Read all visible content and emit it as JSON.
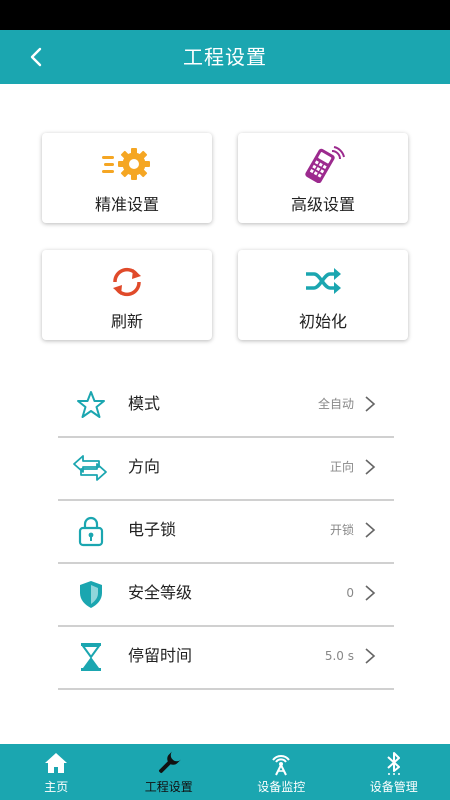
{
  "header": {
    "title": "工程设置"
  },
  "quick_actions": [
    {
      "label": "精准设置",
      "icon": "gear-motion-icon",
      "color": "#f5a623"
    },
    {
      "label": "高级设置",
      "icon": "remote-control-icon",
      "color": "#9c2a8e"
    },
    {
      "label": "刷新",
      "icon": "refresh-icon",
      "color": "#e04a2a"
    },
    {
      "label": "初始化",
      "icon": "shuffle-icon",
      "color": "#1ba6b0"
    }
  ],
  "settings": [
    {
      "label": "模式",
      "value": "全自动",
      "icon": "star-icon"
    },
    {
      "label": "方向",
      "value": "正向",
      "icon": "direction-arrows-icon"
    },
    {
      "label": "电子锁",
      "value": "开锁",
      "icon": "lock-icon"
    },
    {
      "label": "安全等级",
      "value": "0",
      "icon": "shield-icon"
    },
    {
      "label": "停留时间",
      "value": "5.0 s",
      "icon": "hourglass-icon"
    }
  ],
  "tabbar": {
    "active": 1,
    "tabs": [
      {
        "label": "主页",
        "icon": "home-icon"
      },
      {
        "label": "工程设置",
        "icon": "wrench-icon"
      },
      {
        "label": "设备监控",
        "icon": "signal-tower-icon"
      },
      {
        "label": "设备管理",
        "icon": "bluetooth-icon"
      }
    ]
  },
  "colors": {
    "accent": "#1ba6b0",
    "divider": "#d0d0d0",
    "value_text": "#888888"
  }
}
